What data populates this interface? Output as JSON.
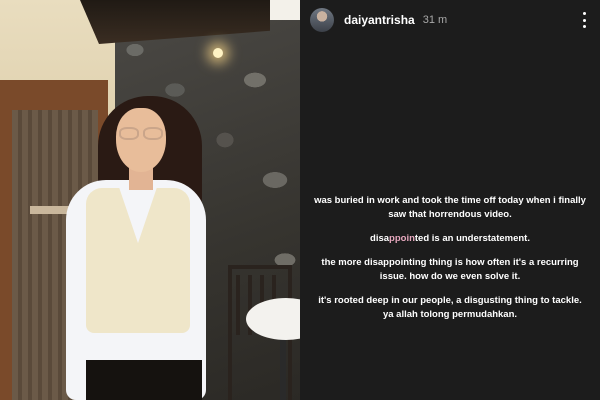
{
  "story": {
    "username": "daiyantrisha",
    "timestamp": "31 m",
    "avatar_icon": "profile-avatar",
    "menu_icon": "more-vertical-icon"
  },
  "caption": {
    "paragraph1": "was buried in work and took the time off today when i finally saw that horrendous video.",
    "paragraph2": {
      "part_a": "disa",
      "highlight": "ppoin",
      "part_b": "ted is an understatement."
    },
    "paragraph3": "the more disappointing thing is how often it's a recurring issue. how do we even solve it.",
    "paragraph4": "it's rooted deep in our people, a disgusting thing to tackle. ya allah tolong permudahkan."
  },
  "colors": {
    "background": "#1c1c1c",
    "text": "#ffffff",
    "timestamp": "#a8a8a8",
    "highlight_word": "#e8a9bf"
  }
}
